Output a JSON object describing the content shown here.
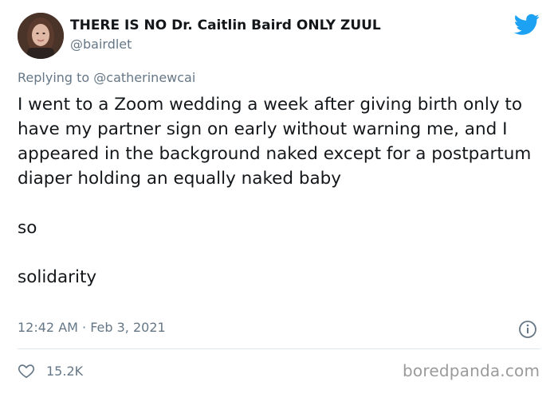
{
  "author": {
    "display_name": "THERE IS NO Dr. Caitlin Baird ONLY ZUUL",
    "handle": "@bairdlet",
    "avatar_icon": "profile-photo"
  },
  "brand": {
    "logo_icon": "twitter-bird-icon",
    "color": "#1da1f2"
  },
  "reply": {
    "text": "Replying to @catherinewcai"
  },
  "tweet": {
    "paragraphs": [
      "I went to a Zoom wedding a week after giving birth only to have my partner sign on early without warning me, and I appeared in the background naked except for a postpartum diaper holding an equally naked baby",
      "so",
      "solidarity"
    ],
    "timestamp": "12:42 AM · Feb 3, 2021"
  },
  "actions": {
    "like_icon": "heart-icon",
    "like_count": "15.2K",
    "info_icon": "info-icon"
  },
  "watermark": {
    "text": "boredpanda.com"
  },
  "colors": {
    "text": "#14171a",
    "muted": "#657786",
    "divider": "#e1e8ed",
    "watermark": "#9a9a9a"
  }
}
